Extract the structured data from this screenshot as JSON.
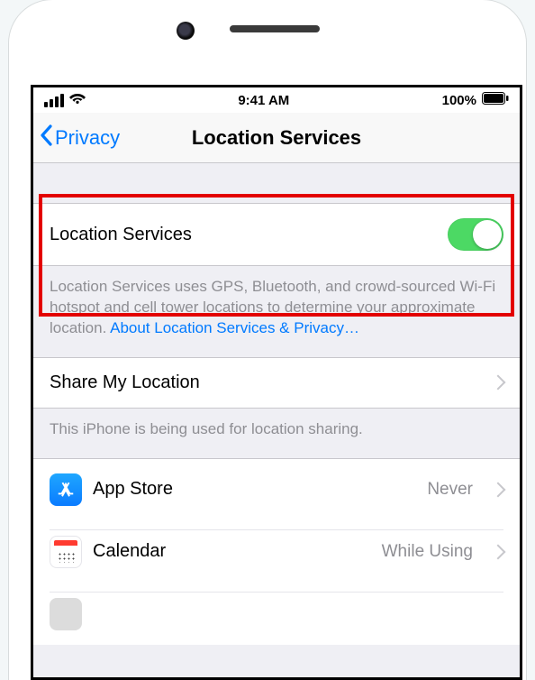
{
  "statusbar": {
    "time": "9:41 AM",
    "battery_text": "100%"
  },
  "nav": {
    "back_label": "Privacy",
    "title": "Location Services"
  },
  "toggle_row": {
    "label": "Location Services",
    "enabled": true
  },
  "explainer": {
    "text": "Location Services uses GPS, Bluetooth, and crowd-sourced Wi-Fi hotspot and cell tower locations to determine your approximate location. ",
    "link": "About Location Services & Privacy…"
  },
  "share_row": {
    "label": "Share My Location"
  },
  "share_footer": "This iPhone is being used for location sharing.",
  "apps": [
    {
      "name": "App Store",
      "status": "Never"
    },
    {
      "name": "Calendar",
      "status": "While Using"
    }
  ]
}
